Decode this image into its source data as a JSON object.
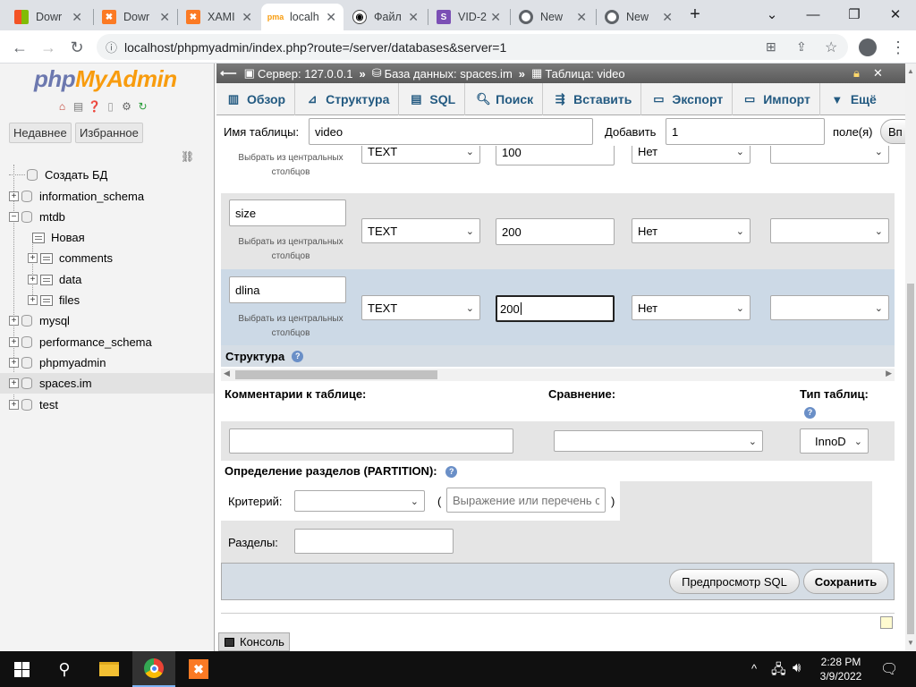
{
  "browser": {
    "tabs": [
      {
        "title": "Dowr",
        "icon": "windows-icon"
      },
      {
        "title": "Dowr",
        "icon": "xampp-icon"
      },
      {
        "title": "XAMI",
        "icon": "xampp-icon"
      },
      {
        "title": "localh",
        "icon": "phpmyadmin-icon",
        "active": true
      },
      {
        "title": "Файл",
        "icon": "file-icon"
      },
      {
        "title": "VID-2",
        "icon": "s-icon"
      },
      {
        "title": "New",
        "icon": "chrome-icon"
      },
      {
        "title": "New",
        "icon": "chrome-icon"
      }
    ],
    "url": "localhost/phpmyadmin/index.php?route=/server/databases&server=1"
  },
  "sidebar": {
    "logo_php": "php",
    "logo_myadmin": "MyAdmin",
    "recent_label": "Недавнее",
    "favorites_label": "Избранное",
    "tree": [
      {
        "label": "Создать БД"
      },
      {
        "label": "information_schema"
      },
      {
        "label": "mtdb"
      },
      {
        "label": "Новая"
      },
      {
        "label": "comments"
      },
      {
        "label": "data"
      },
      {
        "label": "files"
      },
      {
        "label": "mysql"
      },
      {
        "label": "performance_schema"
      },
      {
        "label": "phpmyadmin"
      },
      {
        "label": "spaces.im"
      },
      {
        "label": "test"
      }
    ]
  },
  "breadcrumb": {
    "server": "Сервер: 127.0.0.1",
    "database": "База данных: spaces.im",
    "table": "Таблица: video"
  },
  "menu": [
    {
      "label": "Обзор"
    },
    {
      "label": "Структура"
    },
    {
      "label": "SQL"
    },
    {
      "label": "Поиск"
    },
    {
      "label": "Вставить"
    },
    {
      "label": "Экспорт"
    },
    {
      "label": "Импорт"
    },
    {
      "label": "Ещё"
    }
  ],
  "form": {
    "table_name_label": "Имя таблицы:",
    "table_name_value": "video",
    "add_label": "Добавить",
    "add_value": "1",
    "fields_label": "поле(я)",
    "go_button": "Вп",
    "central_hint": "Выбрать из центральных столбцов",
    "rows": [
      {
        "name": "",
        "type": "TEXT",
        "length": "100",
        "default": "Нет"
      },
      {
        "name": "size",
        "type": "TEXT",
        "length": "200",
        "default": "Нет"
      },
      {
        "name": "dlina",
        "type": "TEXT",
        "length": "200",
        "default": "Нет"
      }
    ],
    "structure_label": "Структура",
    "comments_label": "Комментарии к таблице:",
    "collation_label": "Сравнение:",
    "table_type_label": "Тип таблиц:",
    "engine_value": "InnoD",
    "partition_label": "Определение разделов (PARTITION):",
    "criterion_label": "Критерий:",
    "expression_placeholder": "Выражение или перечень с",
    "partitions_label": "Разделы:",
    "preview_sql_button": "Предпросмотр SQL",
    "save_button": "Сохранить"
  },
  "console_label": "Консоль",
  "taskbar": {
    "time": "2:28 PM",
    "date": "3/9/2022"
  }
}
